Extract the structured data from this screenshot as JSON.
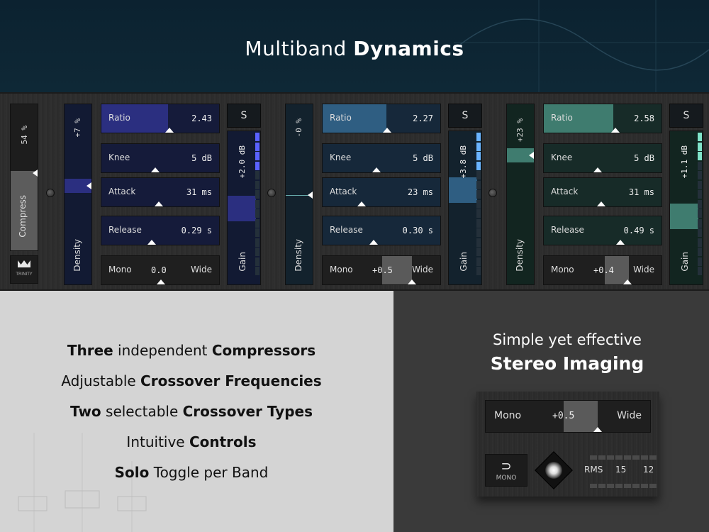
{
  "header": {
    "title_regular": "Multiband",
    "title_bold": "Dynamics"
  },
  "compressor": {
    "value": "54 %",
    "label": "Compress",
    "logo_text": "TRINITY",
    "level": 0.54
  },
  "bands": [
    {
      "color": "#2b2f80",
      "density": {
        "value": "+7 %",
        "label": "Density",
        "level": 0.55
      },
      "ratio": {
        "label": "Ratio",
        "value": "2.43",
        "level": 0.57
      },
      "knee": {
        "label": "Knee",
        "value": "5 dB",
        "level": 0.45
      },
      "attack": {
        "label": "Attack",
        "value": "31 ms",
        "level": 0.48
      },
      "release": {
        "label": "Release",
        "value": "0.29 s",
        "level": 0.42
      },
      "width": {
        "left": "Mono",
        "value": "0.0",
        "right": "Wide",
        "level": 0.5
      },
      "solo": "S",
      "gain": {
        "value": "+2.0 dB",
        "label": "Gain",
        "level": 0.5
      }
    },
    {
      "color": "#2f5e82",
      "density": {
        "value": "-0 %",
        "label": "Density",
        "level": 0.5
      },
      "ratio": {
        "label": "Ratio",
        "value": "2.27",
        "level": 0.54
      },
      "knee": {
        "label": "Knee",
        "value": "5 dB",
        "level": 0.45
      },
      "attack": {
        "label": "Attack",
        "value": "23 ms",
        "level": 0.33
      },
      "release": {
        "label": "Release",
        "value": "0.30 s",
        "level": 0.43
      },
      "width": {
        "left": "Mono",
        "value": "+0.5",
        "right": "Wide",
        "level": 0.75
      },
      "solo": "S",
      "gain": {
        "value": "+3.8 dB",
        "label": "Gain",
        "level": 0.62
      }
    },
    {
      "color": "#3f7c6f",
      "density": {
        "value": "+23 %",
        "label": "Density",
        "level": 0.72
      },
      "ratio": {
        "label": "Ratio",
        "value": "2.58",
        "level": 0.6
      },
      "knee": {
        "label": "Knee",
        "value": "5 dB",
        "level": 0.45
      },
      "attack": {
        "label": "Attack",
        "value": "31 ms",
        "level": 0.48
      },
      "release": {
        "label": "Release",
        "value": "0.49 s",
        "level": 0.64
      },
      "width": {
        "left": "Mono",
        "value": "+0.4",
        "right": "Wide",
        "level": 0.7
      },
      "solo": "S",
      "gain": {
        "value": "+1.1 dB",
        "label": "Gain",
        "level": 0.45
      }
    }
  ],
  "features": [
    {
      "bold1": "Three",
      "text1": " independent ",
      "bold2": "Compressors"
    },
    {
      "bold1": "",
      "text1": "Adjustable ",
      "bold2": "Crossover Frequencies"
    },
    {
      "bold1": "Two",
      "text1": " selectable ",
      "bold2": "Crossover Types"
    },
    {
      "bold1": "",
      "text1": "Intuitive ",
      "bold2": "Controls"
    },
    {
      "bold1": "Solo",
      "text1": " Toggle per Band",
      "bold2": ""
    }
  ],
  "imaging": {
    "line1": "Simple yet effective",
    "line2": "Stereo Imaging",
    "slider": {
      "left": "Mono",
      "value": "+0.5",
      "right": "Wide",
      "level": 0.72
    },
    "mono_button": "MONO",
    "rms_label": "RMS",
    "rms_left": "15",
    "rms_right": "12"
  }
}
